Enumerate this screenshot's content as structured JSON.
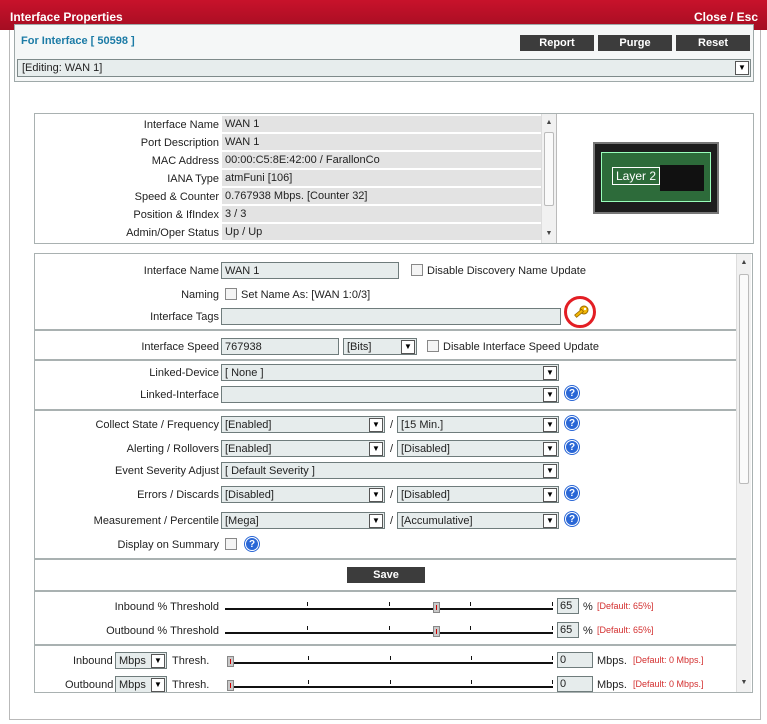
{
  "window": {
    "title": "Interface Properties",
    "close_label": "Close / Esc"
  },
  "header": {
    "for_interface": "For Interface [ 50598 ]",
    "buttons": {
      "report": "Report",
      "purge": "Purge",
      "reset": "Reset"
    },
    "editing_select": "[Editing: WAN 1]"
  },
  "info": {
    "rows": [
      {
        "label": "Interface Name",
        "value": "WAN 1"
      },
      {
        "label": "Port Description",
        "value": "WAN 1"
      },
      {
        "label": "MAC Address",
        "value": "00:00:C5:8E:42:00 / FarallonCo"
      },
      {
        "label": "IANA Type",
        "value": "atmFuni [106]"
      },
      {
        "label": "Speed & Counter",
        "value": "0.767938 Mbps. [Counter 32]"
      },
      {
        "label": "Position & IfIndex",
        "value": "3 / 3"
      },
      {
        "label": "Admin/Oper Status",
        "value": "Up / Up"
      }
    ],
    "image_label": "Layer 2"
  },
  "form": {
    "interface_name": {
      "label": "Interface Name",
      "value": "WAN 1",
      "disable_label": "Disable Discovery Name Update"
    },
    "naming": {
      "label": "Naming",
      "checkbox_label": "Set Name As: [WAN 1:0/3]"
    },
    "interface_tags": {
      "label": "Interface Tags",
      "value": ""
    },
    "interface_speed": {
      "label": "Interface Speed",
      "value": "767938",
      "unit": "[Bits]",
      "disable_label": "Disable Interface Speed Update"
    },
    "linked_device": {
      "label": "Linked-Device",
      "value": "[ None ]"
    },
    "linked_interface": {
      "label": "Linked-Interface",
      "value": ""
    },
    "collect_state": {
      "label": "Collect State / Frequency",
      "value1": "[Enabled]",
      "value2": "[15 Min.]"
    },
    "alerting": {
      "label": "Alerting / Rollovers",
      "value1": "[Enabled]",
      "value2": "[Disabled]"
    },
    "event_severity": {
      "label": "Event Severity Adjust",
      "value": "[ Default Severity ]"
    },
    "errors": {
      "label": "Errors / Discards",
      "value1": "[Disabled]",
      "value2": "[Disabled]"
    },
    "measurement": {
      "label": "Measurement / Percentile",
      "value1": "[Mega]",
      "value2": "[Accumulative]"
    },
    "display_summary": {
      "label": "Display on Summary"
    },
    "slash": "/",
    "help": "?",
    "save_label": "Save",
    "inbound_threshold": {
      "label": "Inbound % Threshold",
      "value": "65",
      "unit": "%",
      "default": "[Default: 65%]",
      "level": 0.65
    },
    "outbound_threshold": {
      "label": "Outbound % Threshold",
      "value": "65",
      "unit": "%",
      "default": "[Default: 65%]",
      "level": 0.65
    },
    "inbound_thresh": {
      "label_prefix": "Inbound",
      "unit_select": "Mbps",
      "label_suffix": "Thresh.",
      "value": "0",
      "unit": "Mbps.",
      "default": "[Default: 0 Mbps.]",
      "level": 0
    },
    "outbound_thresh": {
      "label_prefix": "Outbound",
      "unit_select": "Mbps",
      "label_suffix": "Thresh.",
      "value": "0",
      "unit": "Mbps.",
      "default": "[Default: 0 Mbps.]",
      "level": 0
    }
  }
}
